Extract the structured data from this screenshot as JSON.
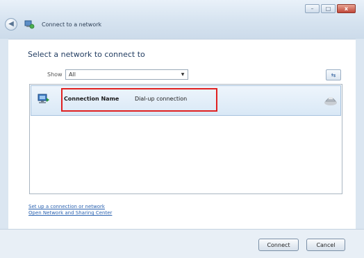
{
  "window": {
    "title": "Connect to a network",
    "caption_buttons": {
      "minimize": "–",
      "maximize": "□",
      "close": "x"
    }
  },
  "main": {
    "heading": "Select a network to connect to",
    "filter": {
      "label": "Show",
      "value": "All"
    },
    "connections": [
      {
        "name": "Connection Name",
        "type": "Dial-up connection",
        "icon": "dialup-connection-icon",
        "status_icon": "phone-modem-icon"
      }
    ],
    "links": [
      "Set up a connection or network",
      "Open Network and Sharing Center"
    ]
  },
  "footer": {
    "connect_label": "Connect",
    "cancel_label": "Cancel"
  },
  "colors": {
    "highlight": "#e02020",
    "link": "#2a62b0",
    "heading": "#1f3a5f"
  }
}
